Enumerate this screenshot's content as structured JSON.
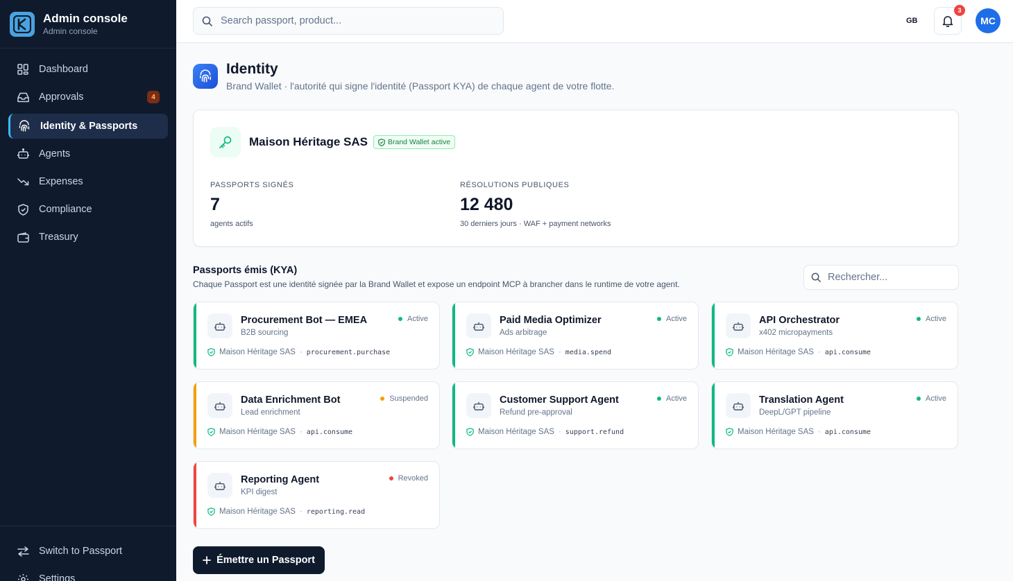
{
  "app": {
    "title": "Admin console",
    "subtitle": "Admin console"
  },
  "sidebar": {
    "items": [
      {
        "label": "Dashboard",
        "icon": "dashboard-icon"
      },
      {
        "label": "Approvals",
        "icon": "inbox-icon",
        "badge": "4"
      },
      {
        "label": "Identity & Passports",
        "icon": "fingerprint-icon",
        "active": true
      },
      {
        "label": "Agents",
        "icon": "robot-icon"
      },
      {
        "label": "Expenses",
        "icon": "trend-down-icon"
      },
      {
        "label": "Compliance",
        "icon": "shield-icon"
      },
      {
        "label": "Treasury",
        "icon": "wallet-icon"
      }
    ],
    "bottom": [
      {
        "label": "Switch to Passport",
        "icon": "switch-icon"
      },
      {
        "label": "Settings",
        "icon": "gear-icon"
      }
    ]
  },
  "topbar": {
    "search_placeholder": "Search passport, product...",
    "locale": "GB",
    "notifications": "3",
    "avatar_initials": "MC"
  },
  "header": {
    "title": "Identity",
    "subtitle": "Brand Wallet · l'autorité qui signe l'identité (Passport KYA) de chaque agent de votre flotte."
  },
  "wallet": {
    "name": "Maison Héritage SAS",
    "badge": "Brand Wallet active",
    "stats": [
      {
        "label": "Passports signés",
        "value": "7",
        "note": "agents actifs"
      },
      {
        "label": "Résolutions publiques",
        "value": "12 480",
        "note": "30 derniers jours · WAF + payment networks"
      }
    ]
  },
  "passports": {
    "title": "Passports émis (KYA)",
    "subtitle": "Chaque Passport est une identité signée par la Brand Wallet et expose un endpoint MCP à brancher dans le runtime de votre agent.",
    "filter_placeholder": "Rechercher...",
    "items": [
      {
        "name": "Procurement Bot — EMEA",
        "purpose": "B2B sourcing",
        "status": "Active",
        "issuer": "Maison Héritage SAS",
        "scope": "procurement.purchase"
      },
      {
        "name": "Paid Media Optimizer",
        "purpose": "Ads arbitrage",
        "status": "Active",
        "issuer": "Maison Héritage SAS",
        "scope": "media.spend"
      },
      {
        "name": "API Orchestrator",
        "purpose": "x402 micropayments",
        "status": "Active",
        "issuer": "Maison Héritage SAS",
        "scope": "api.consume"
      },
      {
        "name": "Data Enrichment Bot",
        "purpose": "Lead enrichment",
        "status": "Suspended",
        "issuer": "Maison Héritage SAS",
        "scope": "api.consume"
      },
      {
        "name": "Customer Support Agent",
        "purpose": "Refund pre-approval",
        "status": "Active",
        "issuer": "Maison Héritage SAS",
        "scope": "support.refund"
      },
      {
        "name": "Translation Agent",
        "purpose": "DeepL/GPT pipeline",
        "status": "Active",
        "issuer": "Maison Héritage SAS",
        "scope": "api.consume"
      },
      {
        "name": "Reporting Agent",
        "purpose": "KPI digest",
        "status": "Revoked",
        "issuer": "Maison Héritage SAS",
        "scope": "reporting.read"
      }
    ],
    "separator": "·"
  },
  "actions": {
    "emit_label": "Émettre un Passport"
  },
  "colors": {
    "sidebar_bg": "#0f1b2d",
    "accent": "#38bdf8",
    "status_active": "#10b981",
    "status_suspended": "#f59e0b",
    "status_revoked": "#ef4444"
  }
}
